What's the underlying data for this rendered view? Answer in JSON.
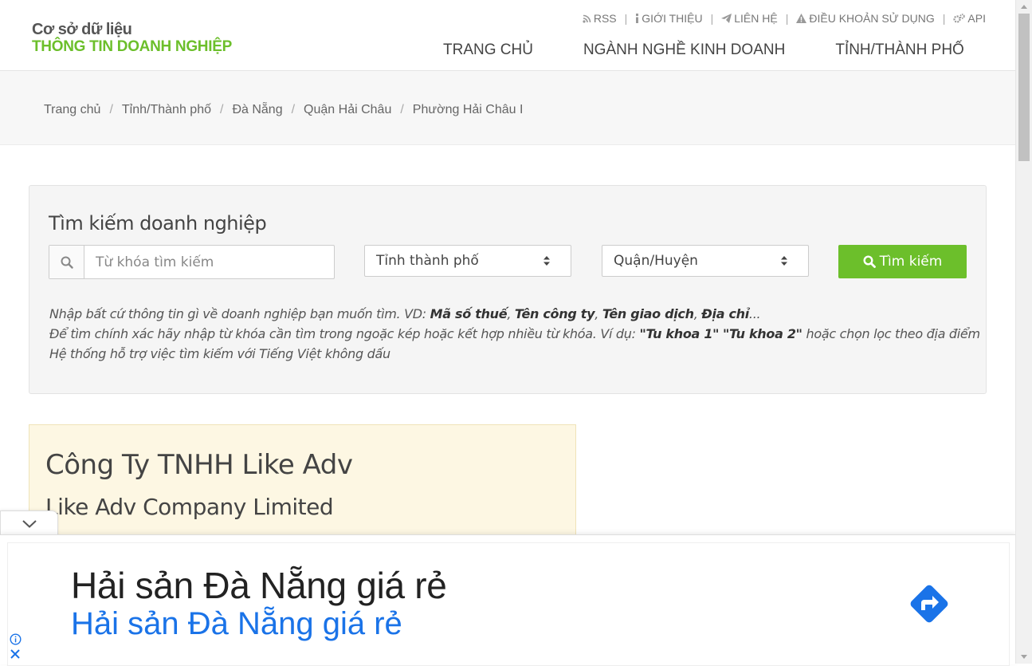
{
  "header": {
    "logo_line1": "Cơ sở dữ liệu",
    "logo_line2": "THÔNG TIN DOANH NGHIỆP",
    "top_links": [
      {
        "icon": "rss-icon",
        "label": "RSS"
      },
      {
        "icon": "info-icon",
        "label": "GIỚI THIỆU"
      },
      {
        "icon": "paper-plane-icon",
        "label": "LIÊN HỆ"
      },
      {
        "icon": "warning-icon",
        "label": "ĐIỀU KHOẢN SỬ DỤNG"
      },
      {
        "icon": "gears-icon",
        "label": "API"
      }
    ],
    "nav": [
      "TRANG CHỦ",
      "NGÀNH NGHỀ KINH DOANH",
      "TỈNH/THÀNH PHỐ"
    ]
  },
  "breadcrumb": [
    "Trang chủ",
    "Tỉnh/Thành phố",
    "Đà Nẵng",
    "Quận Hải Châu",
    "Phường Hải Châu I"
  ],
  "search": {
    "title": "Tìm kiếm doanh nghiệp",
    "placeholder": "Từ khóa tìm kiếm",
    "province_selected": "Tỉnh thành phố",
    "district_selected": "Quận/Huyện",
    "button": "Tìm kiếm",
    "hint1_prefix": "Nhập bất cứ thông tin gì về doanh nghiệp bạn muốn tìm. VD: ",
    "hint1_b1": "Mã số thuế",
    "hint1_b2": "Tên công ty",
    "hint1_b3": "Tên giao dịch",
    "hint1_b4": "Địa chỉ",
    "hint1_suffix": "...",
    "hint2_prefix": "Để tìm chính xác hãy nhập từ khóa cần tìm trong ngoặc kép hoặc kết hợp nhiều từ khóa. Ví dụ: ",
    "hint2_b1": "\"Tu khoa 1\"",
    "hint2_b2": "\"Tu khoa 2\"",
    "hint2_suffix": " hoặc chọn lọc theo địa điểm",
    "hint3": "Hệ thống hỗ trợ việc tìm kiếm với Tiếng Việt không dấu"
  },
  "company": {
    "name": "Công Ty TNHH Like Adv",
    "name_en": "Like Adv Company Limited"
  },
  "ad": {
    "title": "Hải sản Đà Nẵng giá rẻ",
    "subtitle": "Hải sản Đà Nẵng giá rẻ",
    "accent": "#1a73e8"
  },
  "colors": {
    "brand_green": "#6cbf2b",
    "card_bg": "#fdf7e3"
  }
}
